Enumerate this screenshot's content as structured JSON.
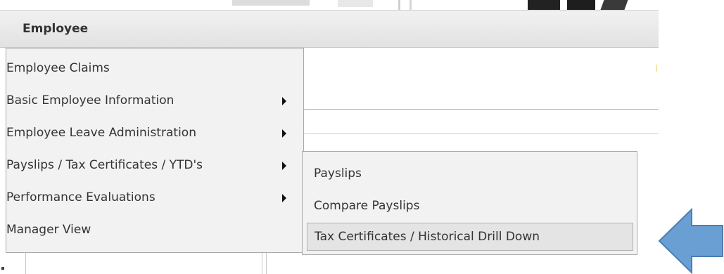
{
  "header": {
    "title": "Employee"
  },
  "menu": {
    "items": [
      {
        "label": "Employee Claims",
        "has_submenu": false
      },
      {
        "label": "Basic Employee Information",
        "has_submenu": true
      },
      {
        "label": "Employee Leave Administration",
        "has_submenu": true
      },
      {
        "label": "Payslips / Tax Certificates / YTD's",
        "has_submenu": true
      },
      {
        "label": "Performance Evaluations",
        "has_submenu": true
      },
      {
        "label": "Manager View",
        "has_submenu": false
      }
    ]
  },
  "submenu": {
    "items": [
      {
        "label": "Payslips"
      },
      {
        "label": "Compare Payslips"
      },
      {
        "label": "Tax Certificates / Historical Drill Down",
        "highlighted": true
      }
    ]
  },
  "colors": {
    "pointer_arrow": "#6a9fd4",
    "pointer_arrow_stroke": "#4a7fb4"
  }
}
